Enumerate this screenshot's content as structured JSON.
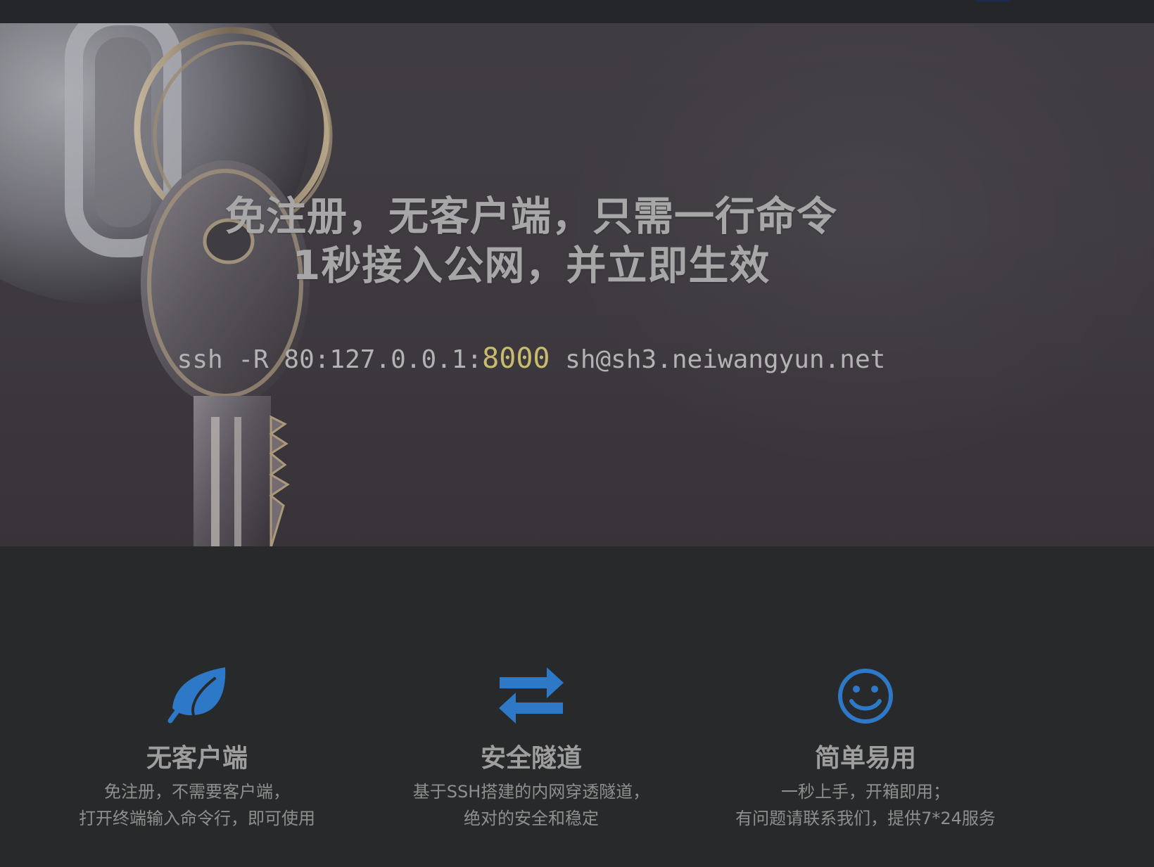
{
  "colors": {
    "accent_blue": "#2e79c7",
    "port_highlight": "#c7bb6e",
    "page_background": "#27292a",
    "topbar_background": "#242629"
  },
  "hero": {
    "background_image": "key-ring-image",
    "title_line1": "免注册，无客户端，只需一行命令",
    "title_line2": "1秒接入公网，并立即生效",
    "command": {
      "prefix": "ssh -R 80:127.0.0.1:",
      "port": "8000",
      "suffix": " sh@sh3.neiwangyun.net"
    }
  },
  "features": [
    {
      "icon": "leaf-icon",
      "title": "无客户端",
      "desc_line1": "免注册，不需要客户端，",
      "desc_line2": "打开终端输入命令行，即可使用"
    },
    {
      "icon": "exchange-arrows-icon",
      "title": "安全隧道",
      "desc_line1": "基于SSH搭建的内网穿透隧道，",
      "desc_line2": "绝对的安全和稳定"
    },
    {
      "icon": "smile-icon",
      "title": "简单易用",
      "desc_line1": "一秒上手，开箱即用；",
      "desc_line2": "有问题请联系我们，提供7*24服务"
    }
  ]
}
